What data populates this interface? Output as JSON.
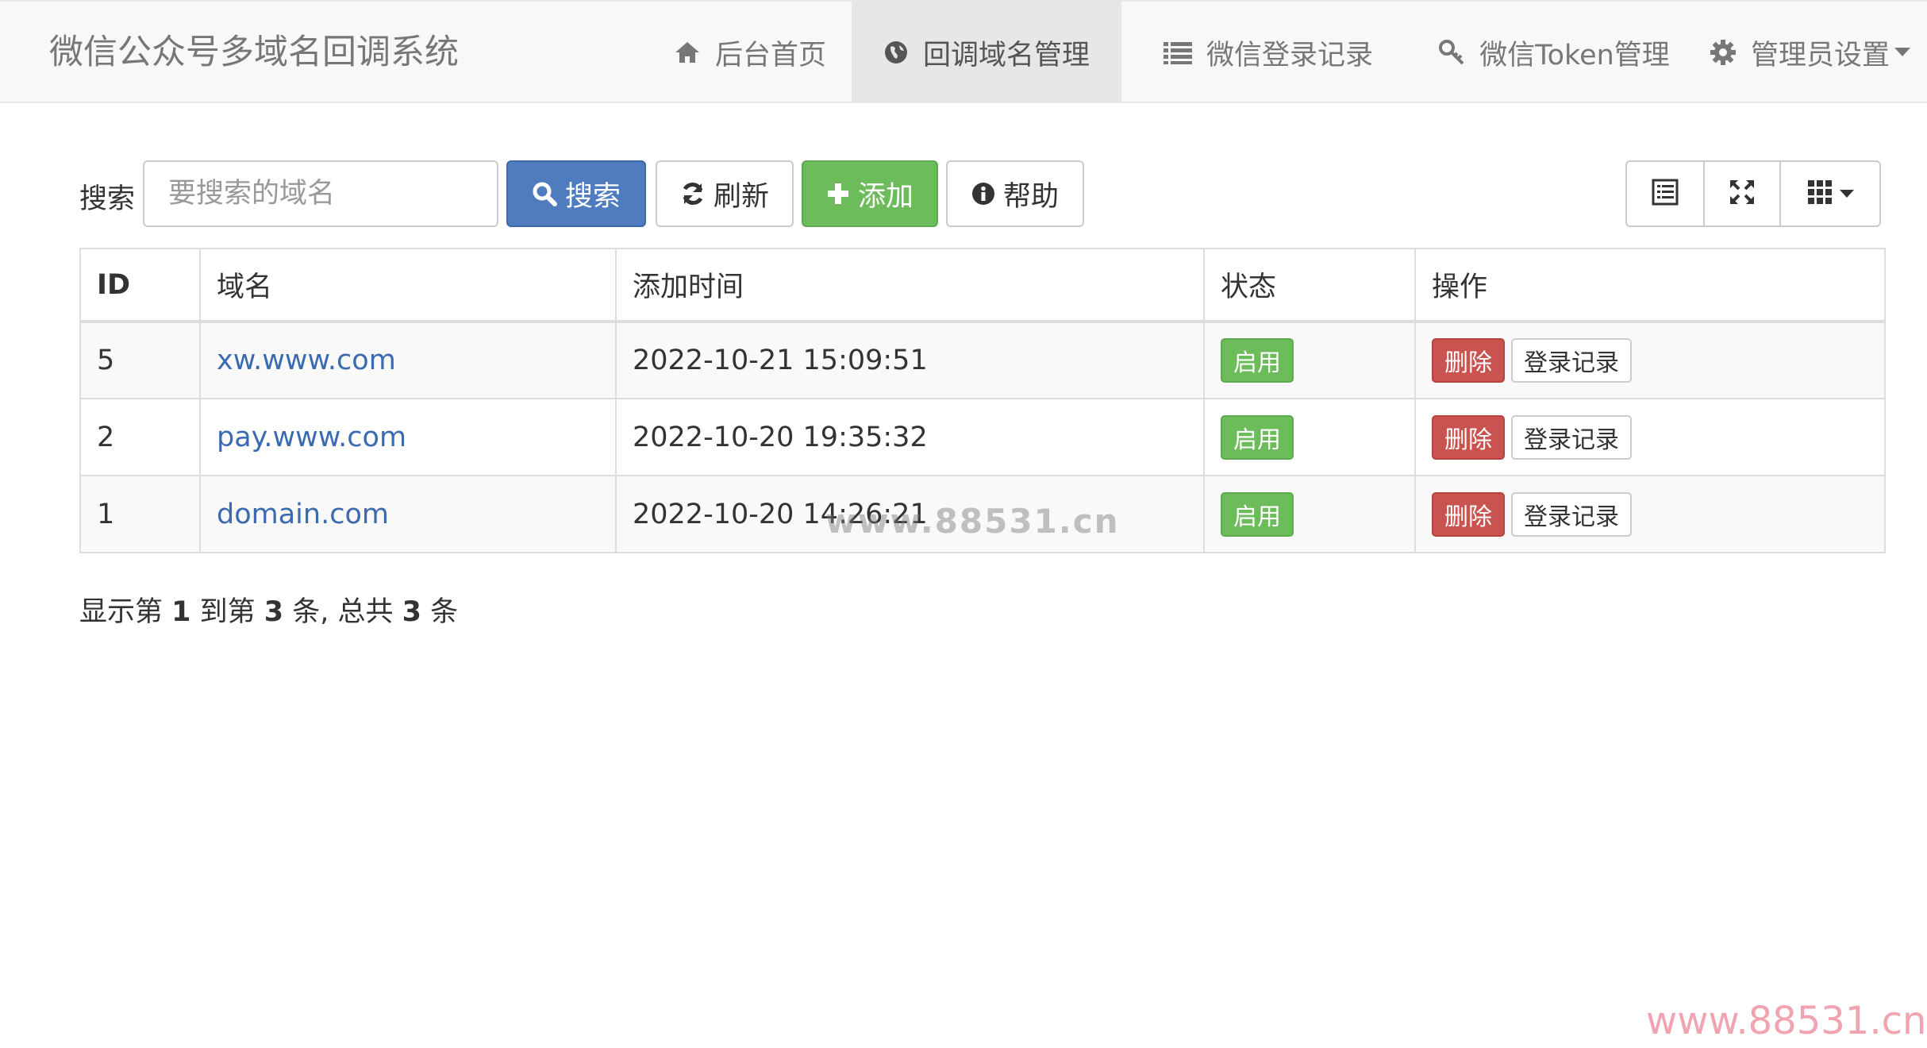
{
  "navbar": {
    "brand": "微信公众号多域名回调系统",
    "items": [
      {
        "label": "后台首页",
        "icon": "home-icon",
        "active": false
      },
      {
        "label": "回调域名管理",
        "icon": "globe-icon",
        "active": true
      },
      {
        "label": "微信登录记录",
        "icon": "list-icon",
        "active": false
      },
      {
        "label": "微信Token管理",
        "icon": "key-icon",
        "active": false
      },
      {
        "label": "管理员设置",
        "icon": "gear-icon",
        "active": false
      }
    ]
  },
  "toolbar": {
    "search_label": "搜索",
    "search_placeholder": "要搜索的域名",
    "search_value": "",
    "search_button": "搜索",
    "refresh_button": "刷新",
    "add_button": "添加",
    "help_button": "帮助",
    "view_buttons": [
      "toggle-view-icon",
      "fullscreen-icon",
      "columns-icon"
    ]
  },
  "table": {
    "headers": [
      "ID",
      "域名",
      "添加时间",
      "状态",
      "操作"
    ],
    "rows": [
      {
        "id": "5",
        "domain": "xw.www.com",
        "time": "2022-10-21 15:09:51",
        "status": "启用",
        "delete": "删除",
        "log": "登录记录"
      },
      {
        "id": "2",
        "domain": "pay.www.com",
        "time": "2022-10-20 19:35:32",
        "status": "启用",
        "delete": "删除",
        "log": "登录记录"
      },
      {
        "id": "1",
        "domain": "domain.com",
        "time": "2022-10-20 14:26:21",
        "status": "启用",
        "delete": "删除",
        "log": "登录记录"
      }
    ]
  },
  "pagination": {
    "prefix": "显示第 ",
    "from": "1",
    "mid1": " 到第 ",
    "to": "3",
    "mid2": " 条, 总共 ",
    "total": "3",
    "suffix": " 条"
  },
  "watermarks": {
    "center": "www.88531.cn",
    "corner": "www.88531.cn"
  },
  "colors": {
    "primary": "#4f7cbf",
    "success": "#6cbc5c",
    "danger": "#c9534f",
    "link": "#3a6ab0",
    "navbar_bg": "#f8f8f8"
  }
}
